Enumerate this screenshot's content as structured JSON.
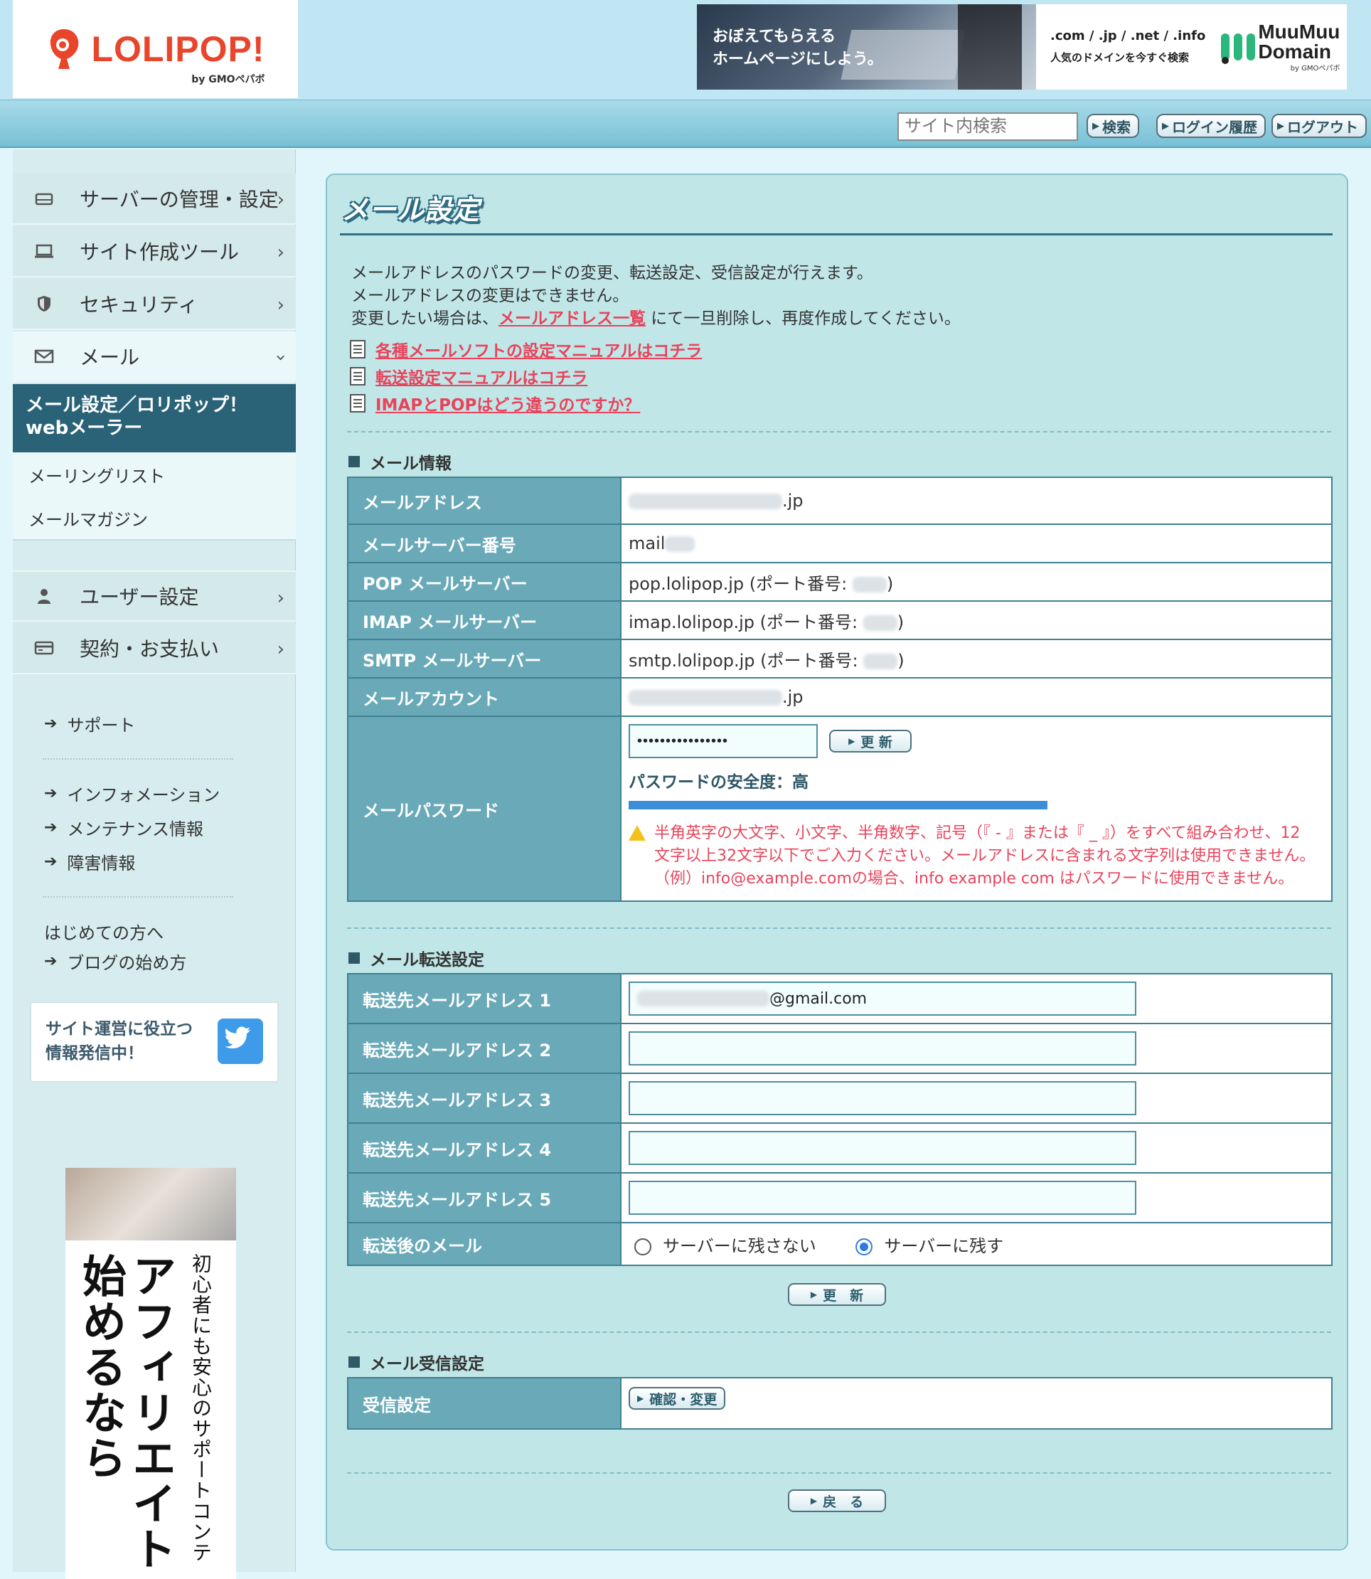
{
  "header": {
    "logo_text": "LOLIPOP!",
    "logo_by": "by GMOペパボ",
    "ad_headline_line1": "おぼえてもらえる",
    "ad_headline_line2": "ホームページにしよう。",
    "ad_tlds": ".com / .jp / .net / .info",
    "ad_tagline": "人気のドメインを今すぐ検索",
    "ad_brand_line1": "MuuMuu",
    "ad_brand_line2": "Domain",
    "ad_brand_by": "by GMOペパボ"
  },
  "toolbar": {
    "search_placeholder": "サイト内検索",
    "search_button": "検索",
    "history_button": "ログイン履歴",
    "logout_button": "ログアウト"
  },
  "sidebar": {
    "items": [
      {
        "label": "サーバーの管理・設定",
        "icon": "server-icon"
      },
      {
        "label": "サイト作成ツール",
        "icon": "laptop-icon"
      },
      {
        "label": "セキュリティ",
        "icon": "shield-icon"
      },
      {
        "label": "メール",
        "icon": "mail-icon"
      }
    ],
    "active_sub": "メール設定／ロリポップ！webメーラー",
    "sub_items": [
      "メーリングリスト",
      "メールマガジン"
    ],
    "items_lower": [
      {
        "label": "ユーザー設定",
        "icon": "user-icon"
      },
      {
        "label": "契約・お支払い",
        "icon": "card-icon"
      }
    ],
    "links": {
      "support": "サポート",
      "information": "インフォメーション",
      "maintenance": "メンテナンス情報",
      "trouble": "障害情報",
      "beginners": "はじめての方へ",
      "blog": "ブログの始め方"
    },
    "twitter_line1": "サイト運営に役立つ",
    "twitter_line2": "情報発信中！",
    "ad_big": "アフィリエイト始めるなら",
    "ad_small": "初心者にも安心のサポートコンテ"
  },
  "main": {
    "title": "メール設定",
    "desc_line1": "メールアドレスのパスワードの変更、転送設定、受信設定が行えます。",
    "desc_line2": "メールアドレスの変更はできません。",
    "desc_line3_pre": "変更したい場合は、",
    "desc_line3_link": "メールアドレス一覧",
    "desc_line3_post": " にて一旦削除し、再度作成してください。",
    "manual_links": [
      "各種メールソフトの設定マニュアルはコチラ",
      "転送設定マニュアルはコチラ",
      "IMAPとPOPはどう違うのですか？"
    ],
    "info": {
      "section_title": "メール情報",
      "labels": {
        "address": "メールアドレス",
        "server_no": "メールサーバー番号",
        "pop": "POP メールサーバー",
        "imap": "IMAP メールサーバー",
        "smtp": "SMTP メールサーバー",
        "account": "メールアカウント",
        "password": "メールパスワード"
      },
      "address_suffix": ".jp",
      "server_prefix": "mail",
      "pop_pre": "pop.lolipop.jp (ポート番号: ",
      "imap_pre": "imap.lolipop.jp (ポート番号: ",
      "smtp_pre": "smtp.lolipop.jp (ポート番号: ",
      "paren_close": ")",
      "account_suffix": ".jp",
      "password_value": "••••••••••••••••",
      "update_button": "更 新",
      "strength_text": "パスワードの安全度：高",
      "strength_fraction": 0.95,
      "warning_line1": "半角英字の大文字、小文字、半角数字、記号（『 - 』または『 _ 』）をすべて組み合わせ、12",
      "warning_line2": "文字以上32文字以下でご入力ください。メールアドレスに含まれる文字列は使用できません。",
      "warning_line3": "（例）info@example.comの場合、info example com はパスワードに使用できません。"
    },
    "forward": {
      "section_title": "メール転送設定",
      "labels": [
        "転送先メールアドレス 1",
        "転送先メールアドレス 2",
        "転送先メールアドレス 3",
        "転送先メールアドレス 4",
        "転送先メールアドレス 5"
      ],
      "address1_suffix": "@gmail.com",
      "after_label": "転送後のメール",
      "option_no_keep": "サーバーに残さない",
      "option_keep": "サーバーに残す",
      "selected": "サーバーに残す",
      "update_button": "更　新"
    },
    "receive": {
      "section_title": "メール受信設定",
      "label": "受信設定",
      "button": "確認・変更"
    },
    "back_button": "戻　る"
  },
  "colors": {
    "brand_red": "#e8452b",
    "link_red": "#e8445b",
    "table_label_bg": "#69a9b8",
    "sidebar_active": "#2a6378",
    "strength_bar": "#3c8ed8"
  }
}
